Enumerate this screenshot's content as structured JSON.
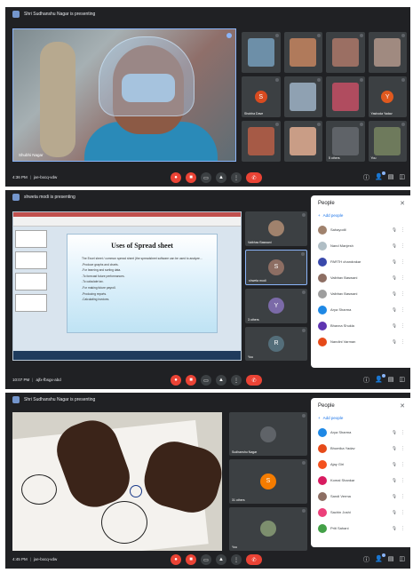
{
  "panel1": {
    "presenter_text": "Shri Sudhanshu Nagar is presenting",
    "time": "4:36 PM",
    "meeting_code": "jxe-bxcq-vdw",
    "main_tile_name": "Shubhi Nagar",
    "tiles": [
      {
        "name": "",
        "avatar": "",
        "color": "#6d8fa8"
      },
      {
        "name": "",
        "avatar": "",
        "color": "#b07a5b"
      },
      {
        "name": "",
        "avatar": "",
        "color": "#9b6f63"
      },
      {
        "name": "",
        "avatar": "",
        "color": "#a08a80"
      },
      {
        "name": "Shobha Dave",
        "avatar": "S",
        "color": "#d84b20"
      },
      {
        "name": "",
        "avatar": "",
        "color": "#8fa1b2"
      },
      {
        "name": "",
        "avatar": "",
        "color": "#b04c5f"
      },
      {
        "name": "Yashoda Yadav",
        "avatar": "Y",
        "color": "#e0591f"
      },
      {
        "name": "",
        "avatar": "",
        "color": "#a65a46"
      },
      {
        "name": "",
        "avatar": "",
        "color": "#c99d86"
      },
      {
        "name": "5 others",
        "avatar": "",
        "color": "#5f6368"
      },
      {
        "name": "You",
        "avatar": "",
        "color": "#6e7a5c"
      }
    ]
  },
  "panel2": {
    "presenter_text": "shweta modi is presenting",
    "time": "10:07 PM",
    "meeting_code": "ajfx-fbsgx-abd",
    "slide_title": "Uses of Spread sheet",
    "slide_bullets": [
      "The Excel sheet / common spread sheet (the spreadsheet software can be used to analyze...",
      "-Produce graphs and charts.",
      "-For learning and sorting data.",
      "-To forecast future performances.",
      "-To calculate tax.",
      "-For making future payroll.",
      "-Producing reports.",
      "-Calculating invoices."
    ],
    "tiles": [
      {
        "name": "Vaibhav Baswani",
        "avatar": "",
        "color": "#a0826d"
      },
      {
        "name": "shweta modi",
        "avatar": "S",
        "color": "#8d6e63"
      },
      {
        "name": "3 others",
        "avatar": "Y",
        "color": "#7b6aa8"
      },
      {
        "name": "You",
        "avatar": "R",
        "color": "#546e7a"
      }
    ],
    "people": {
      "title": "People",
      "add_label": "Add people",
      "list": [
        {
          "name": "Sahayodil",
          "color": "#a0826d"
        },
        {
          "name": "Nand Manjesh",
          "color": "#b0bec5"
        },
        {
          "name": "PARTH chandrakar",
          "color": "#3949ab"
        },
        {
          "name": "Vaibhav Baswani",
          "color": "#8d6e63"
        },
        {
          "name": "Vaibhav Baswani",
          "color": "#9e9e9e"
        },
        {
          "name": "Arya Sharma",
          "color": "#1e88e5"
        },
        {
          "name": "Bhavna Shukla",
          "color": "#5e35b1"
        },
        {
          "name": "Nandini Varman",
          "color": "#e64a19"
        }
      ]
    }
  },
  "panel3": {
    "presenter_text": "Shri Sudhanshu Nagar is presenting",
    "time": "4:45 PM",
    "meeting_code": "jxe-bxcq-vdw",
    "tiles": [
      {
        "name": "Sudhanshu Nagar",
        "avatar": "",
        "color": "#5f6368"
      },
      {
        "name": "31 others",
        "avatar": "S",
        "color": "#f57c00"
      },
      {
        "name": "You",
        "avatar": "",
        "color": "#7d8f6e"
      }
    ],
    "people": {
      "title": "People",
      "add_label": "Add people",
      "list": [
        {
          "name": "Arya Sharma",
          "color": "#1e88e5"
        },
        {
          "name": "Bhumika Yadav",
          "color": "#e64a19"
        },
        {
          "name": "Ajay Giri",
          "color": "#f4511e"
        },
        {
          "name": "Komal Shankar",
          "color": "#d81b60"
        },
        {
          "name": "Sandi Verma",
          "color": "#8d6e63"
        },
        {
          "name": "Sachin Joshi",
          "color": "#ec407a"
        },
        {
          "name": "Priti Sahani",
          "color": "#43a047"
        }
      ]
    }
  },
  "icons": {
    "mic": "🎤",
    "cam": "📷",
    "cc": "CC",
    "present": "⬆",
    "more": "⋮",
    "end": "✆",
    "info": "ⓘ",
    "people": "👤",
    "chat": "💬",
    "activities": "⬚",
    "close": "✕",
    "add_person": "+👤",
    "pin": "📌"
  }
}
